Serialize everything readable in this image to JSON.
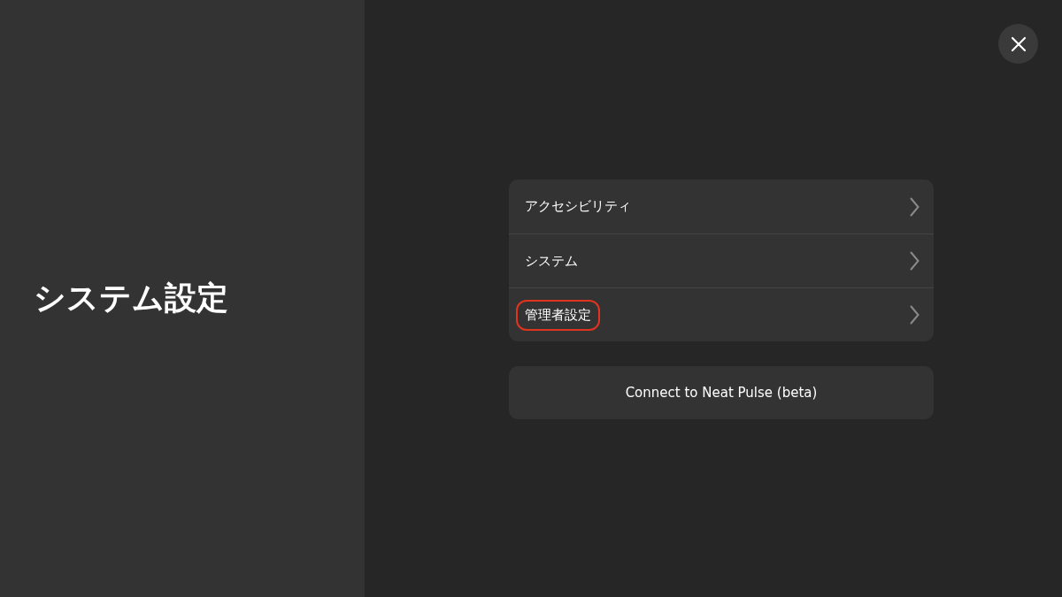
{
  "sidebar": {
    "title": "システム設定"
  },
  "menu": {
    "items": [
      {
        "label": "アクセシビリティ",
        "highlighted": false
      },
      {
        "label": "システム",
        "highlighted": false
      },
      {
        "label": "管理者設定",
        "highlighted": true
      }
    ]
  },
  "action_button": {
    "label": "Connect to Neat Pulse (beta)"
  }
}
